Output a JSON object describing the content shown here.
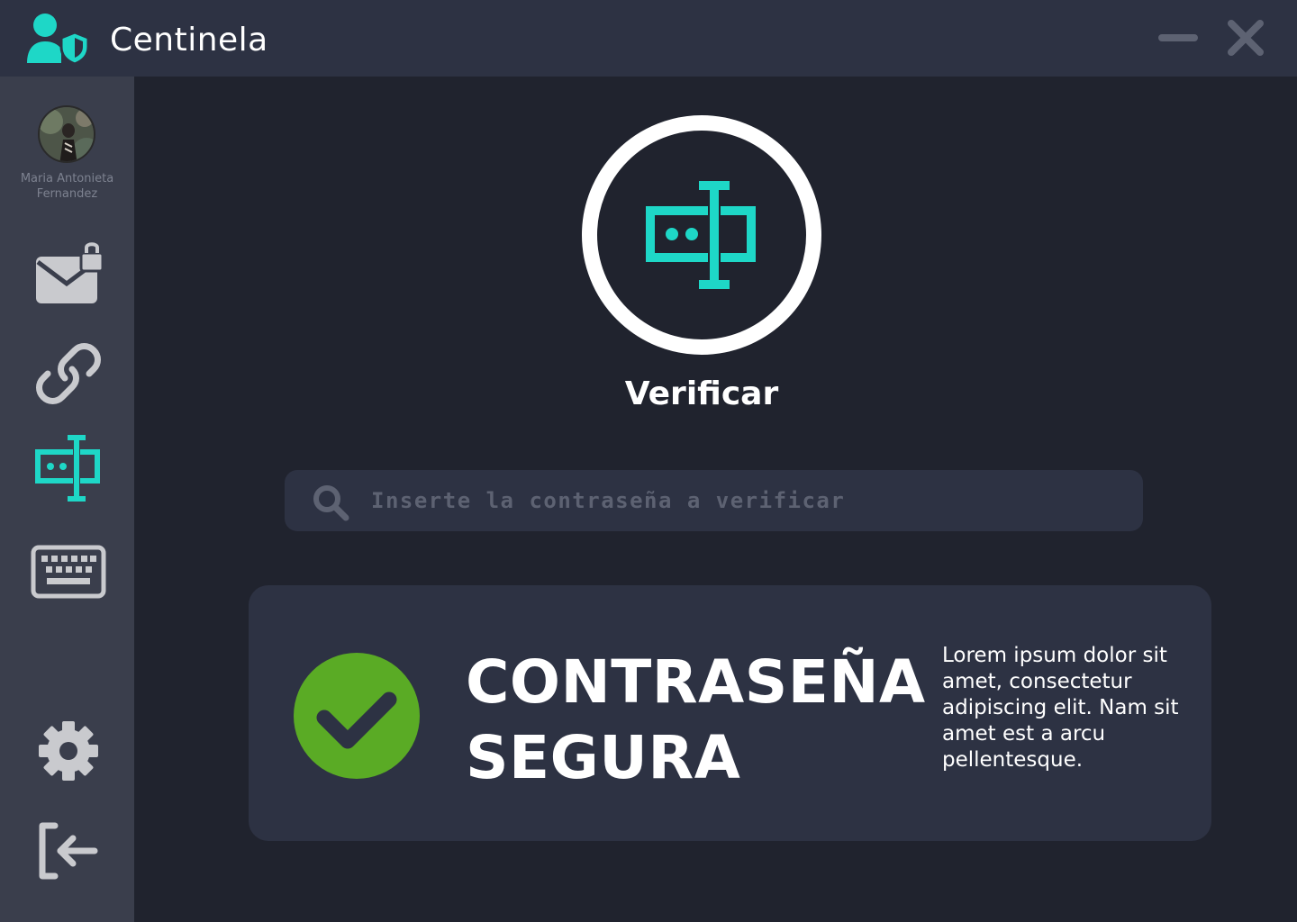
{
  "app": {
    "title": "Centinela",
    "colors": {
      "accent": "#1ed7c7",
      "success": "#5aab25",
      "icon_muted": "#c9cace"
    }
  },
  "user": {
    "name_line1": "Maria Antonieta",
    "name_line2": "Fernandez"
  },
  "sidebar": {
    "items": [
      {
        "icon": "mail-lock-icon",
        "active": false
      },
      {
        "icon": "link-icon",
        "active": false
      },
      {
        "icon": "password-field-icon",
        "active": true
      },
      {
        "icon": "keyboard-icon",
        "active": false
      },
      {
        "icon": "gear-icon",
        "active": false
      },
      {
        "icon": "logout-icon",
        "active": false
      }
    ]
  },
  "main": {
    "title": "Verificar",
    "search": {
      "placeholder": "Inserte la contraseña a verificar",
      "value": ""
    },
    "result": {
      "title_line1": "CONTRASEÑA",
      "title_line2": "SEGURA",
      "description": "Lorem ipsum dolor sit amet, consectetur adipiscing elit. Nam sit amet est a arcu pellentesque."
    }
  }
}
